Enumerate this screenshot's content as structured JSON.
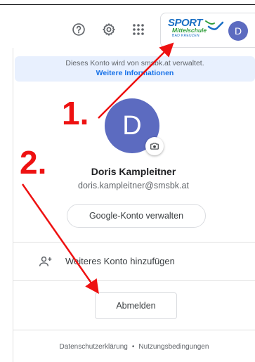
{
  "header": {
    "help_icon": "help-circle-icon",
    "settings_icon": "gear-icon",
    "apps_icon": "apps-grid-icon",
    "org_logo": {
      "line1": "SPORT",
      "line2": "Mittelschule",
      "line3": "BAD KREUZEN",
      "colors": {
        "sport": "#1a6fc4",
        "mittel": "#2f9e3a"
      }
    },
    "avatar_initial": "D"
  },
  "banner": {
    "text": "Dieses Konto wird von smsbk.at verwaltet.",
    "link": "Weitere Informationen"
  },
  "profile": {
    "avatar_initial": "D",
    "avatar_color": "#5c6bc0",
    "camera_icon": "camera-icon",
    "name": "Doris Kampleitner",
    "email": "doris.kampleitner@smsbk.at"
  },
  "actions": {
    "manage_account": "Google-Konto verwalten",
    "add_account": "Weiteres Konto hinzufügen",
    "sign_out": "Abmelden"
  },
  "footer": {
    "privacy": "Datenschutzerklärung",
    "separator": "•",
    "terms": "Nutzungsbedingungen"
  },
  "annotations": {
    "step1": "1.",
    "step2": "2.",
    "color": "#ee1111"
  }
}
